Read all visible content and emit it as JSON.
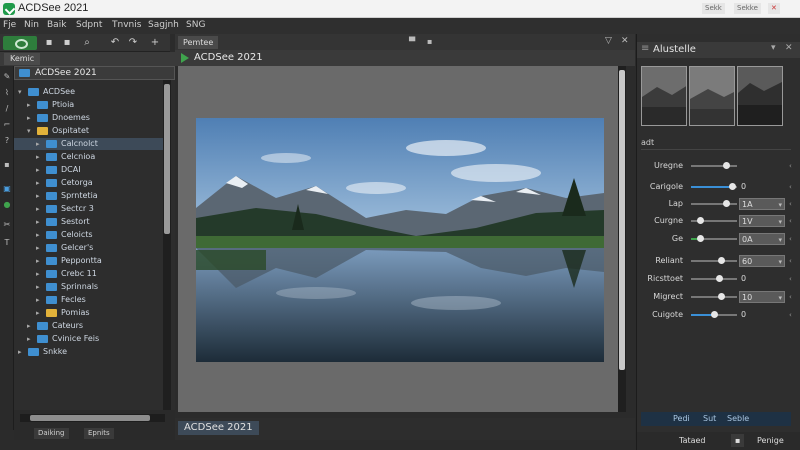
{
  "window": {
    "title": "ACDSee 2021",
    "buttons": [
      "Sekk",
      "Sekke",
      "✕"
    ]
  },
  "menu": [
    "Fje",
    "Nin",
    "Baik",
    "Sdpnt",
    "Tnvnis",
    "Sagjnh",
    "SNG"
  ],
  "toolbar": {
    "icons": [
      "folder-icon",
      "save-icon",
      "zoom-icon",
      "back-icon",
      "forward-icon",
      "add-icon"
    ]
  },
  "left_panel": {
    "tab": "Kemic",
    "header": "ACDSee 2021",
    "tree": [
      {
        "label": "ACDSee",
        "level": 0,
        "color": "blue",
        "expanded": true
      },
      {
        "label": "Ptioia",
        "level": 1,
        "color": "blue"
      },
      {
        "label": "Dnoemes",
        "level": 1,
        "color": "blue"
      },
      {
        "label": "Ospitatet",
        "level": 1,
        "color": "yellow",
        "expanded": true
      },
      {
        "label": "Calcnolct",
        "level": 2,
        "color": "blue",
        "selected": true
      },
      {
        "label": "Celcnioa",
        "level": 2,
        "color": "blue"
      },
      {
        "label": "DCAI",
        "level": 2,
        "color": "blue"
      },
      {
        "label": "Cetorga",
        "level": 2,
        "color": "blue"
      },
      {
        "label": "Sprntetia",
        "level": 2,
        "color": "blue"
      },
      {
        "label": "Sectcr 3",
        "level": 2,
        "color": "blue"
      },
      {
        "label": "Sestort",
        "level": 2,
        "color": "blue"
      },
      {
        "label": "Celoicts",
        "level": 2,
        "color": "blue"
      },
      {
        "label": "Gelcer's",
        "level": 2,
        "color": "blue"
      },
      {
        "label": "Peppontta",
        "level": 2,
        "color": "blue"
      },
      {
        "label": "Crebc 11",
        "level": 2,
        "color": "blue"
      },
      {
        "label": "Sprinnals",
        "level": 2,
        "color": "blue"
      },
      {
        "label": "Fecles",
        "level": 2,
        "color": "blue"
      },
      {
        "label": "Pomias",
        "level": 2,
        "color": "yellow"
      },
      {
        "label": "Cateurs",
        "level": 1,
        "color": "blue"
      },
      {
        "label": "Cvinice Feis",
        "level": 1,
        "color": "blue"
      },
      {
        "label": "Snkke",
        "level": 0,
        "color": "blue"
      }
    ],
    "bottom_tabs": [
      "Daiking",
      "Epnits"
    ]
  },
  "center": {
    "tab": "Pemtee",
    "viewer_title": "ACDSee 2021",
    "bottom_tab": "ACDSee 2021"
  },
  "right_panel": {
    "header": "Alustelle",
    "section": "adt",
    "adjustments": [
      {
        "label": "Uregne",
        "level": 0.75,
        "value": "",
        "box": false,
        "fill": "#777777"
      },
      {
        "label": "Carigole",
        "level": 0.9,
        "value": "0",
        "box": false,
        "fill": "#3a8fd6"
      },
      {
        "label": "Lap",
        "level": 0.75,
        "value": "1A",
        "box": true,
        "fill": "#777777"
      },
      {
        "label": "Curgne",
        "level": 0.2,
        "value": "1V",
        "box": true,
        "fill": "#777777"
      },
      {
        "label": "Ge",
        "level": 0.2,
        "value": "0A",
        "box": true,
        "fill": "#3fa34d"
      },
      {
        "label": "Reliant",
        "level": 0.65,
        "value": "60",
        "box": true,
        "fill": "#777777"
      },
      {
        "label": "Ricsttoet",
        "level": 0.6,
        "value": "0",
        "box": false,
        "fill": "#777777"
      },
      {
        "label": "Migrect",
        "level": 0.65,
        "value": "10",
        "box": true,
        "fill": "#777777"
      },
      {
        "label": "Cuigote",
        "level": 0.5,
        "value": "0",
        "box": false,
        "fill": "#3a8fd6"
      }
    ],
    "bottom_tabs": [
      "Pedi",
      "Sut",
      "Seble"
    ],
    "footer": [
      "Tataed",
      "Penige"
    ]
  }
}
